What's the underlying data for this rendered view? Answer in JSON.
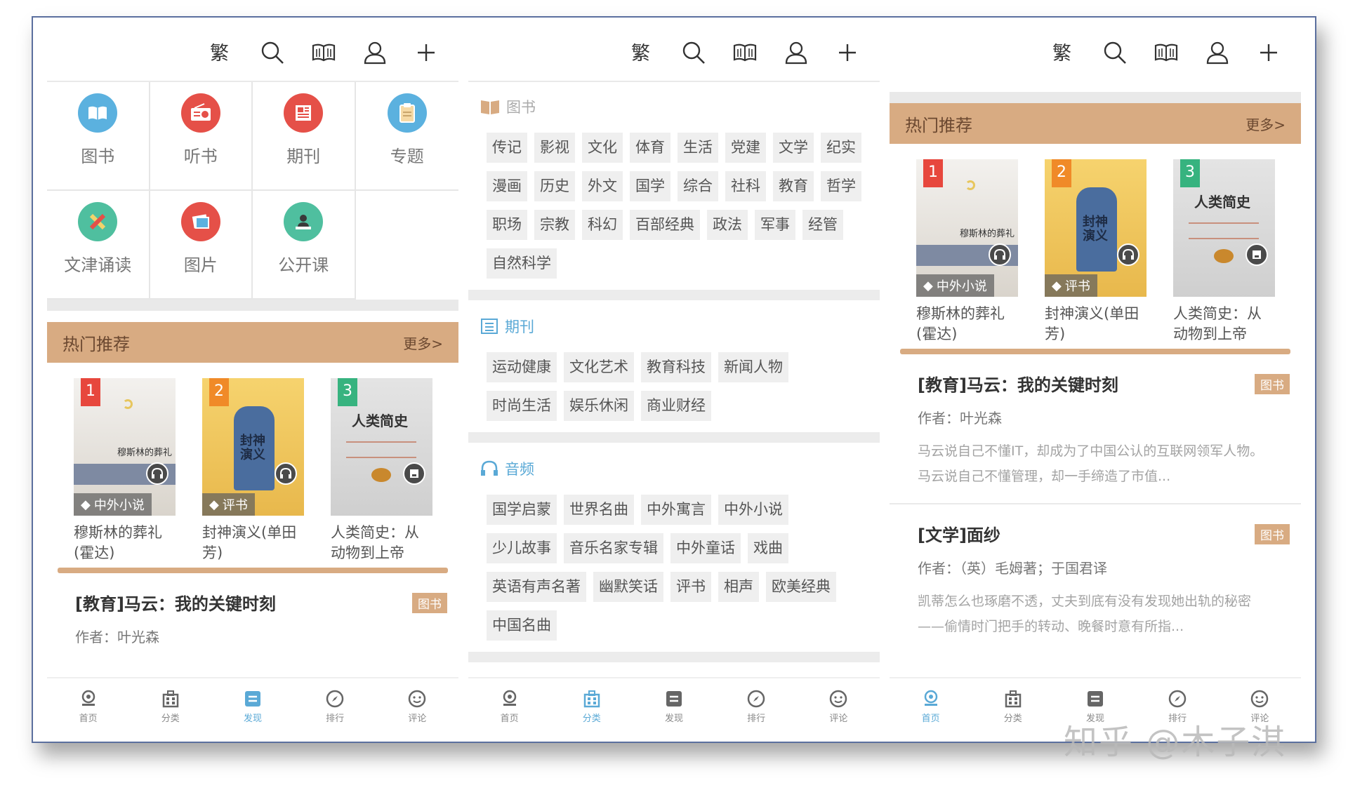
{
  "colors": {
    "accent_brown": "#d8ab82",
    "active_blue": "#5aa9d6"
  },
  "toolbar": {
    "icons": [
      "traditional-simplified-icon",
      "search-icon",
      "book-open-icon",
      "user-icon",
      "plus-icon"
    ]
  },
  "screen1": {
    "categories": [
      {
        "label": "图书",
        "icon": "book-icon",
        "color": "#5bb1df"
      },
      {
        "label": "听书",
        "icon": "radio-icon",
        "color": "#e55048"
      },
      {
        "label": "期刊",
        "icon": "newspaper-icon",
        "color": "#e55048"
      },
      {
        "label": "专题",
        "icon": "clipboard-icon",
        "color": "#5bb1df"
      },
      {
        "label": "文津诵读",
        "icon": "pencil-icon",
        "color": "#4fbf9f"
      },
      {
        "label": "图片",
        "icon": "picture-icon",
        "color": "#e55048"
      },
      {
        "label": "公开课",
        "icon": "teacher-icon",
        "color": "#4fbf9f"
      }
    ],
    "hot": {
      "title": "热门推荐",
      "more": "更多>"
    },
    "books": [
      {
        "rank": "1",
        "tag": "中外小说",
        "name": "穆斯林的葬礼(霍达)",
        "cover_text": "穆斯林的葬礼"
      },
      {
        "rank": "2",
        "tag": "评书",
        "name": "封神演义(单田芳)",
        "cover_text": "封神演义"
      },
      {
        "rank": "3",
        "tag": "",
        "name": "人类简史：从动物到上帝",
        "cover_text": "人类简史"
      }
    ],
    "article": {
      "title": "[教育]马云：我的关键时刻",
      "badge": "图书",
      "author": "作者：叶光森"
    },
    "bottom_nav": [
      {
        "label": "首页",
        "icon": "home-icon",
        "active": false
      },
      {
        "label": "分类",
        "icon": "category-icon",
        "active": false
      },
      {
        "label": "发现",
        "icon": "discover-icon",
        "active": true
      },
      {
        "label": "排行",
        "icon": "compass-icon",
        "active": false
      },
      {
        "label": "评论",
        "icon": "smile-icon",
        "active": false
      }
    ]
  },
  "screen2": {
    "sections": [
      {
        "title": "图书",
        "style": "gray",
        "icon": "book-open-icon",
        "chips": [
          "传记",
          "影视",
          "文化",
          "体育",
          "生活",
          "党建",
          "文学",
          "纪实",
          "漫画",
          "历史",
          "外文",
          "国学",
          "综合",
          "社科",
          "教育",
          "哲学",
          "职场",
          "宗教",
          "科幻",
          "百部经典",
          "政法",
          "军事",
          "经管",
          "自然科学"
        ]
      },
      {
        "title": "期刊",
        "style": "blue",
        "icon": "list-icon",
        "chips": [
          "运动健康",
          "文化艺术",
          "教育科技",
          "新闻人物",
          "时尚生活",
          "娱乐休闲",
          "商业财经"
        ]
      },
      {
        "title": "音频",
        "style": "blue",
        "icon": "headphones-icon",
        "chips": [
          "国学启蒙",
          "世界名曲",
          "中外寓言",
          "中外小说",
          "少儿故事",
          "音乐名家专辑",
          "中外童话",
          "戏曲",
          "英语有声名著",
          "幽默笑话",
          "评书",
          "相声",
          "欧美经典",
          "中国名曲"
        ]
      }
    ],
    "bottom_nav": [
      {
        "label": "首页",
        "icon": "home-icon",
        "active": false
      },
      {
        "label": "分类",
        "icon": "category-icon",
        "active": true
      },
      {
        "label": "发现",
        "icon": "discover-icon",
        "active": false
      },
      {
        "label": "排行",
        "icon": "compass-icon",
        "active": false
      },
      {
        "label": "评论",
        "icon": "smile-icon",
        "active": false
      }
    ]
  },
  "screen3": {
    "hot": {
      "title": "热门推荐",
      "more": "更多>"
    },
    "books": [
      {
        "rank": "1",
        "tag": "中外小说",
        "name": "穆斯林的葬礼(霍达)",
        "cover_text": "穆斯林的葬礼"
      },
      {
        "rank": "2",
        "tag": "评书",
        "name": "封神演义(单田芳)",
        "cover_text": "封神演义"
      },
      {
        "rank": "3",
        "tag": "",
        "name": "人类简史：从动物到上帝",
        "cover_text": "人类简史"
      }
    ],
    "articles": [
      {
        "title": "[教育]马云：我的关键时刻",
        "badge": "图书",
        "author": "作者：叶光森",
        "desc": "马云说自己不懂IT，却成为了中国公认的互联网领军人物。马云说自己不懂管理，却一手缔造了市值..."
      },
      {
        "title": "[文学]面纱",
        "badge": "图书",
        "author": "作者：（英）毛姆著；于国君译",
        "desc": "凯蒂怎么也琢磨不透，丈夫到底有没有发现她出轨的秘密——偷情时门把手的转动、晚餐时意有所指..."
      }
    ],
    "bottom_nav": [
      {
        "label": "首页",
        "icon": "home-icon",
        "active": true
      },
      {
        "label": "分类",
        "icon": "category-icon",
        "active": false
      },
      {
        "label": "发现",
        "icon": "discover-icon",
        "active": false
      },
      {
        "label": "排行",
        "icon": "compass-icon",
        "active": false
      },
      {
        "label": "评论",
        "icon": "smile-icon",
        "active": false
      }
    ]
  },
  "watermark": "知乎 @木子淇"
}
